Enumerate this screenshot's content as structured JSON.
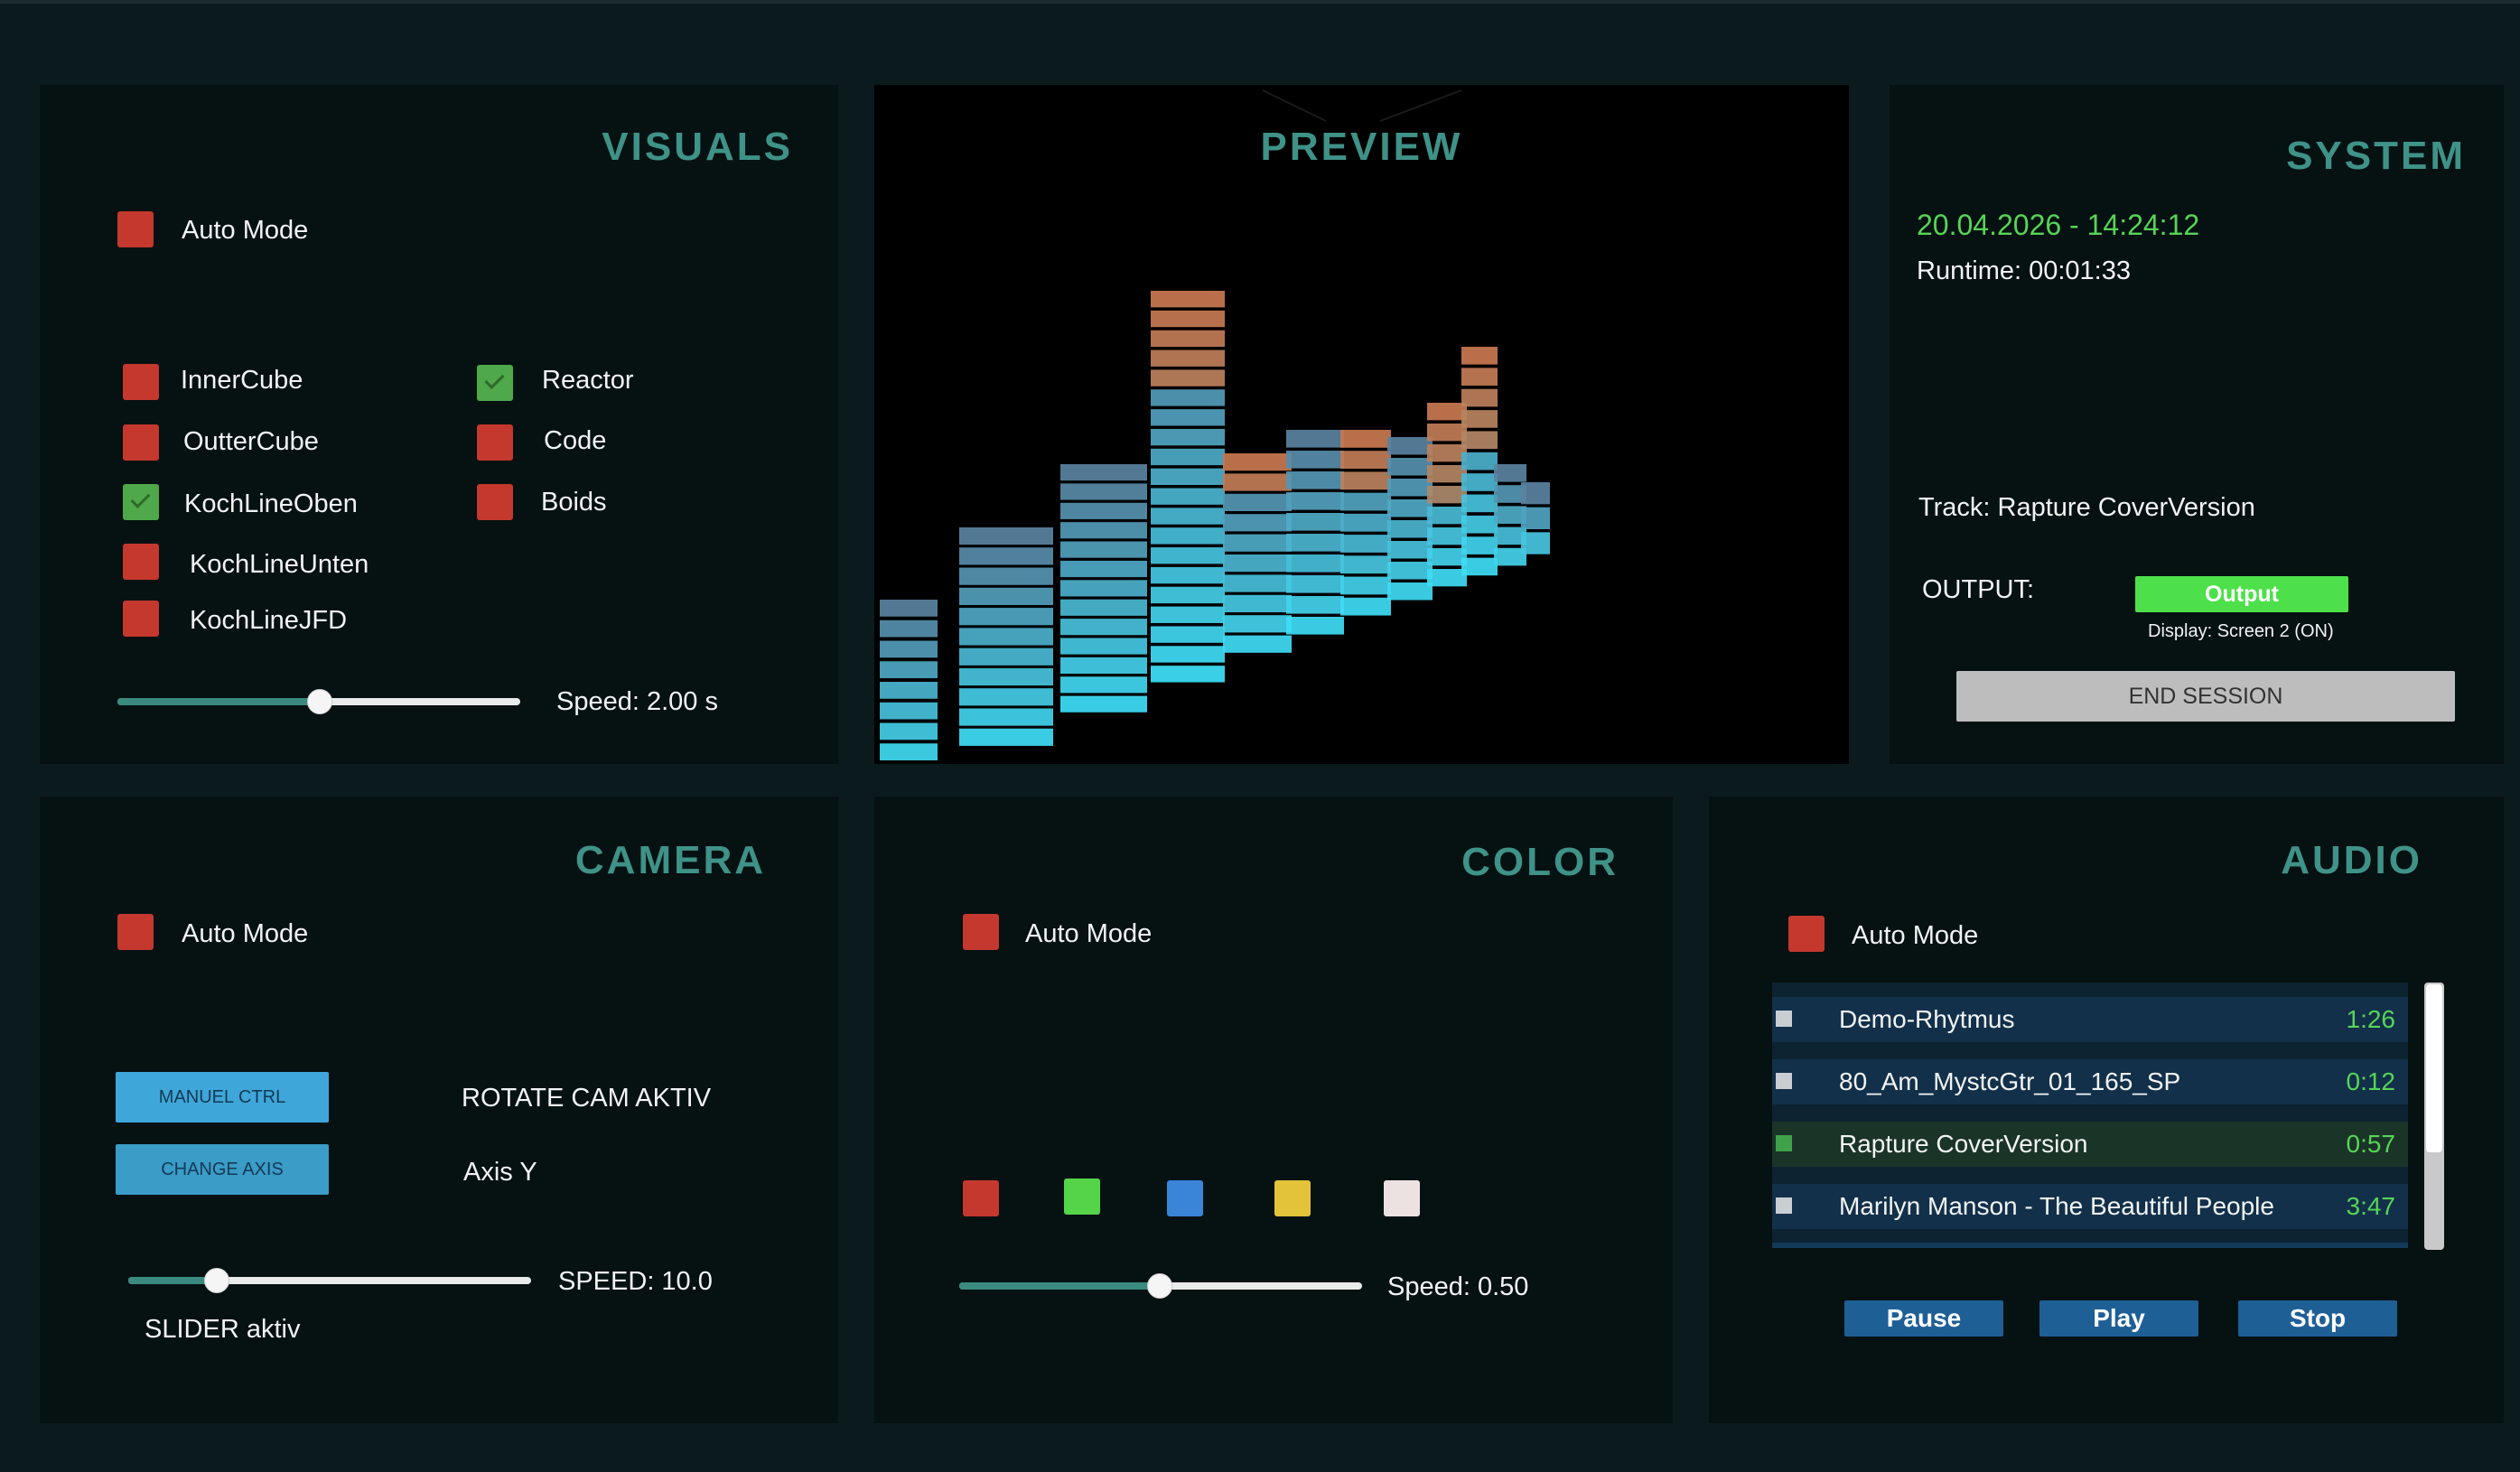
{
  "visuals": {
    "title": "VISUALS",
    "auto_mode": {
      "label": "Auto Mode",
      "checked": false
    },
    "options": [
      {
        "label": "InnerCube",
        "checked": false
      },
      {
        "label": "OutterCube",
        "checked": false
      },
      {
        "label": "KochLineOben",
        "checked": true
      },
      {
        "label": "KochLineUnten",
        "checked": false
      },
      {
        "label": "KochLineJFD",
        "checked": false
      },
      {
        "label": "Reactor",
        "checked": true
      },
      {
        "label": "Code",
        "checked": false
      },
      {
        "label": "Boids",
        "checked": false
      }
    ],
    "speed_label": "Speed: 2.00 s",
    "slider_level": 0.5
  },
  "preview": {
    "title": "PREVIEW"
  },
  "system": {
    "title": "SYSTEM",
    "datetime": "20.04.2026 - 14:24:12",
    "runtime": "Runtime: 00:01:33",
    "track": "Track: Rapture CoverVersion",
    "output_label": "OUTPUT:",
    "output_button": "Output",
    "display_status": "Display: Screen 2 (ON)",
    "end_session": "END SESSION"
  },
  "camera": {
    "title": "CAMERA",
    "auto_mode": {
      "label": "Auto Mode",
      "checked": false
    },
    "manual_ctrl": "MANUEL CTRL",
    "change_axis": "CHANGE AXIS",
    "rotate_status": "ROTATE CAM AKTIV",
    "axis_status": "Axis Y",
    "speed_label": "SPEED: 10.0",
    "slider_status": "SLIDER aktiv",
    "slider_level": 0.22
  },
  "color": {
    "title": "COLOR",
    "auto_mode": {
      "label": "Auto Mode",
      "checked": false
    },
    "swatches": [
      "#c4382e",
      "#55d44a",
      "#3a85d8",
      "#e3c33a",
      "#ece2e2"
    ],
    "speed_label": "Speed: 0.50",
    "slider_level": 0.5
  },
  "audio": {
    "title": "AUDIO",
    "auto_mode": {
      "label": "Auto Mode",
      "checked": false
    },
    "tracks": [
      {
        "name": "Demo-Rhytmus",
        "duration": "1:26",
        "active": false
      },
      {
        "name": "80_Am_MystcGtr_01_165_SP",
        "duration": "0:12",
        "active": false
      },
      {
        "name": "Rapture CoverVersion",
        "duration": "0:57",
        "active": true
      },
      {
        "name": "Marilyn Manson - The Beautiful People",
        "duration": "3:47",
        "active": false
      }
    ],
    "pause": "Pause",
    "play": "Play",
    "stop": "Stop"
  },
  "colors": {
    "background": "#0b1b1d",
    "panel": "#061112",
    "title": "#3f9287",
    "checkbox_off": "#c4382e",
    "checkbox_on": "#4fa84a",
    "datetime": "#57d457",
    "output_button": "#4de04a"
  }
}
